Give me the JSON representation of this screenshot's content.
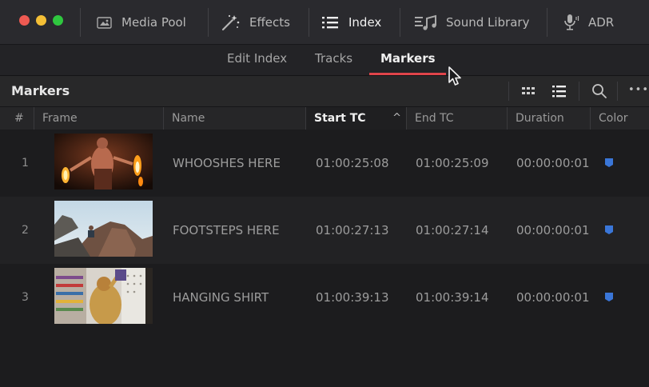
{
  "toolbar": {
    "items": [
      {
        "label": "Media Pool",
        "icon": "media-pool-icon"
      },
      {
        "label": "Effects",
        "icon": "effects-wand-icon"
      },
      {
        "label": "Index",
        "icon": "index-list-icon",
        "active": true
      },
      {
        "label": "Sound Library",
        "icon": "sound-library-icon"
      },
      {
        "label": "ADR",
        "icon": "microphone-icon"
      }
    ]
  },
  "subtabs": {
    "items": [
      {
        "label": "Edit Index"
      },
      {
        "label": "Tracks"
      },
      {
        "label": "Markers",
        "active": true
      }
    ]
  },
  "panel": {
    "title": "Markers",
    "more": "•••"
  },
  "columns": {
    "num": "#",
    "frame": "Frame",
    "name": "Name",
    "start": "Start TC",
    "end": "End TC",
    "duration": "Duration",
    "color": "Color",
    "sort_indicator": "^"
  },
  "markers": [
    {
      "num": "1",
      "name": "WHOOSHES HERE",
      "start": "01:00:25:08",
      "end": "01:00:25:09",
      "duration": "00:00:00:01",
      "color": "#3a76d8"
    },
    {
      "num": "2",
      "name": "FOOTSTEPS HERE",
      "start": "01:00:27:13",
      "end": "01:00:27:14",
      "duration": "00:00:00:01",
      "color": "#3a76d8"
    },
    {
      "num": "3",
      "name": "HANGING SHIRT",
      "start": "01:00:39:13",
      "end": "01:00:39:14",
      "duration": "00:00:00:01",
      "color": "#3a76d8"
    }
  ],
  "colors": {
    "accent_underline": "#e0454a",
    "marker_blue": "#3a76d8"
  }
}
